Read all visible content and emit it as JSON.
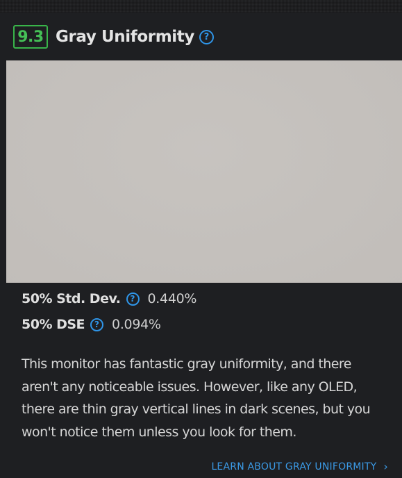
{
  "review": {
    "score": "9.3",
    "title": "Gray Uniformity",
    "help_icon": "?",
    "sample_image_color": "#c5c1bd",
    "metrics": [
      {
        "label": "50% Std. Dev.",
        "value": "0.440%"
      },
      {
        "label": "50% DSE",
        "value": "0.094%"
      }
    ],
    "description": "This monitor has fantastic gray uniformity, and there aren't any noticeable issues. However, like any OLED, there are thin gray vertical lines in dark scenes, but you won't notice them unless you look for them.",
    "learn_more_link": "LEARN ABOUT GRAY UNIFORMITY",
    "learn_more_icon": "›"
  },
  "colors": {
    "score_green": "#45c057",
    "help_blue": "#2f95e8",
    "link_blue": "#3b9ae6",
    "card_bg": "#1e1f22"
  }
}
